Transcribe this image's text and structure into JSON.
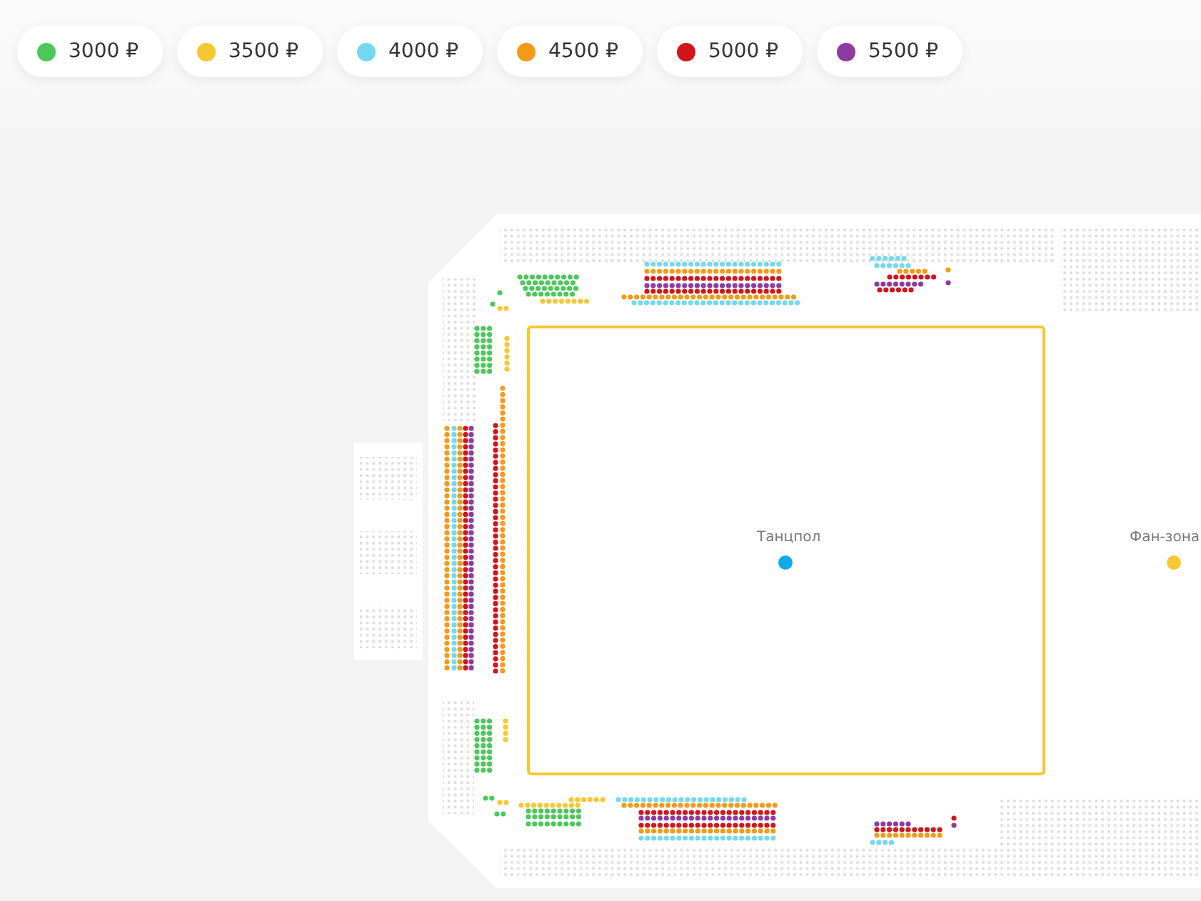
{
  "legend": [
    {
      "label": "3000 ₽",
      "color": "#4cc85a"
    },
    {
      "label": "3500 ₽",
      "color": "#f7c731"
    },
    {
      "label": "4000 ₽",
      "color": "#74d8ee"
    },
    {
      "label": "4500 ₽",
      "color": "#f39a17"
    },
    {
      "label": "5000 ₽",
      "color": "#d0161b"
    },
    {
      "label": "5500 ₽",
      "color": "#8e3aa0"
    }
  ],
  "zones": [
    {
      "label": "Танцпол",
      "color": "#12a8e8"
    },
    {
      "label": "Фан-зона",
      "color": "#f7c731"
    }
  ]
}
